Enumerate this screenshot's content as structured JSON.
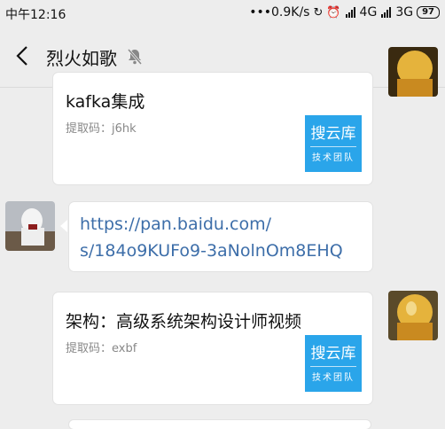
{
  "status_bar": {
    "time": "中午12:16",
    "speed": "•••0.9K/s",
    "network_1": "4G",
    "network_2": "3G",
    "battery": "97"
  },
  "header": {
    "title": "烈火如歌",
    "more": "•••"
  },
  "messages": [
    {
      "title": "kafka集成",
      "code": "提取码：j6hk",
      "logo_main": "搜云库",
      "logo_sub": "技术团队"
    },
    {
      "link_line1": "https://pan.baidu.com/",
      "link_line2": "s/184o9KUFo9-3aNolnOm8EHQ"
    },
    {
      "title": "架构：高级系统架构设计师视频",
      "code": "提取码：exbf",
      "logo_main": "搜云库",
      "logo_sub": "技术团队"
    }
  ]
}
